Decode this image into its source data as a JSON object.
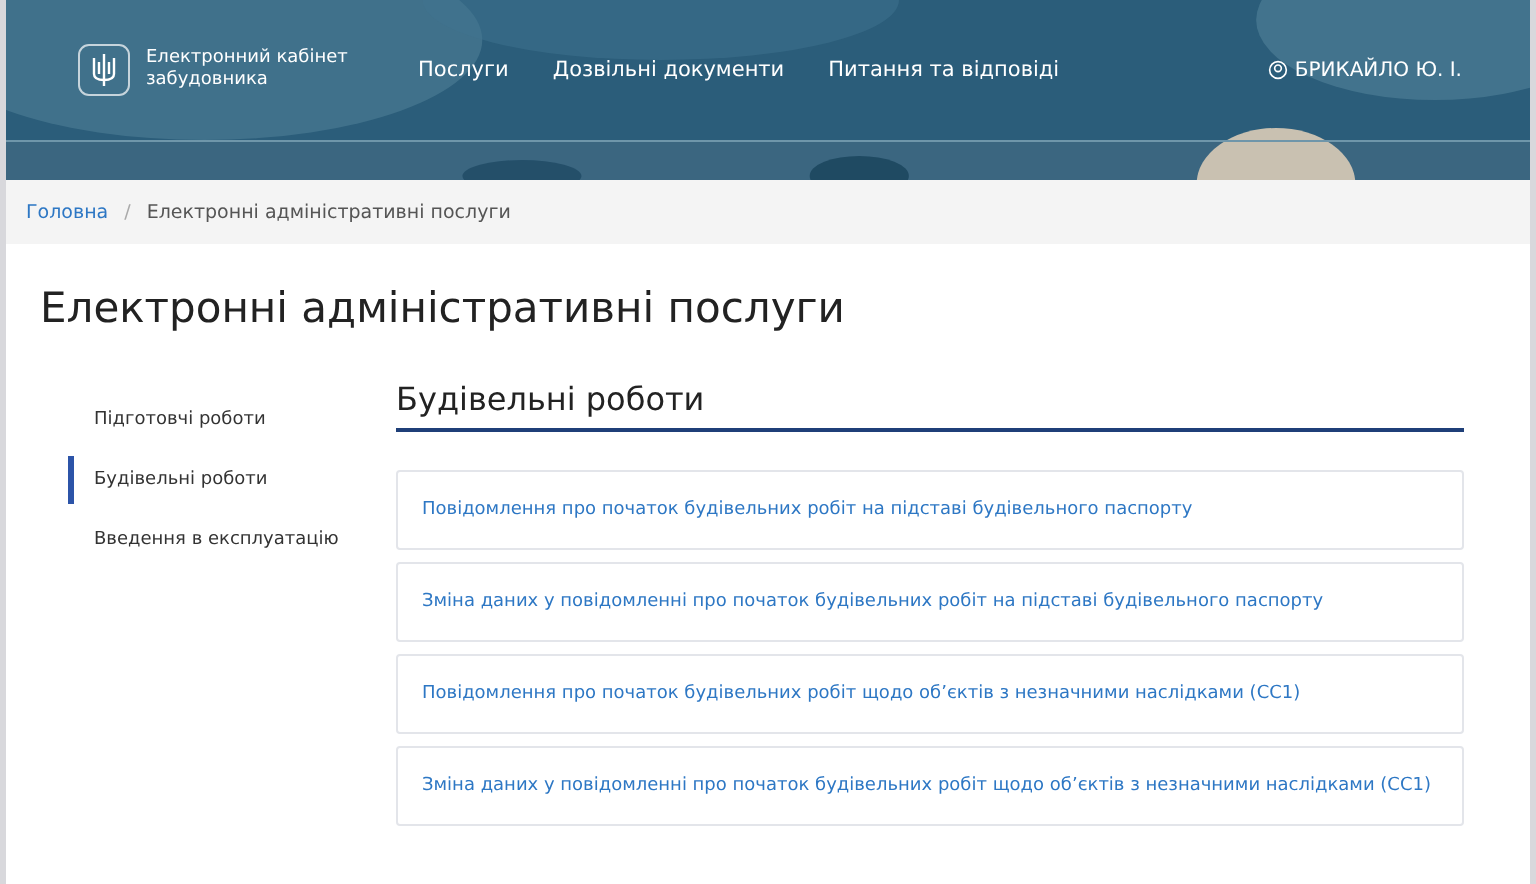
{
  "header": {
    "logo_text": "Електронний кабінет забудовника",
    "nav": [
      "Послуги",
      "Дозвільні документи",
      "Питання та відповіді"
    ],
    "user": "БРИКАЙЛО Ю. І."
  },
  "breadcrumb": {
    "separator": "/",
    "items": [
      "Головна",
      "Електронні адміністративні послуги"
    ]
  },
  "title": "Електронні адміністративні послуги",
  "sidebar": {
    "items": [
      {
        "label": "Підготовчі роботи",
        "selected": false
      },
      {
        "label": "Будівельні роботи",
        "selected": true
      },
      {
        "label": "Введення в експлуатацію",
        "selected": false
      }
    ]
  },
  "section": {
    "title": "Будівельні роботи",
    "items": [
      "Повідомлення про початок будівельних робіт на підставі будівельного паспорту",
      "Зміна даних у повідомленні про початок будівельних робіт на підставі будівельного паспорту",
      "Повідомлення про початок будівельних робіт щодо об’єктів з незначними наслідками (СС1)",
      "Зміна даних у повідомленні про початок будівельних робіт щодо об’єктів з незначними наслідками (СС1)"
    ]
  }
}
